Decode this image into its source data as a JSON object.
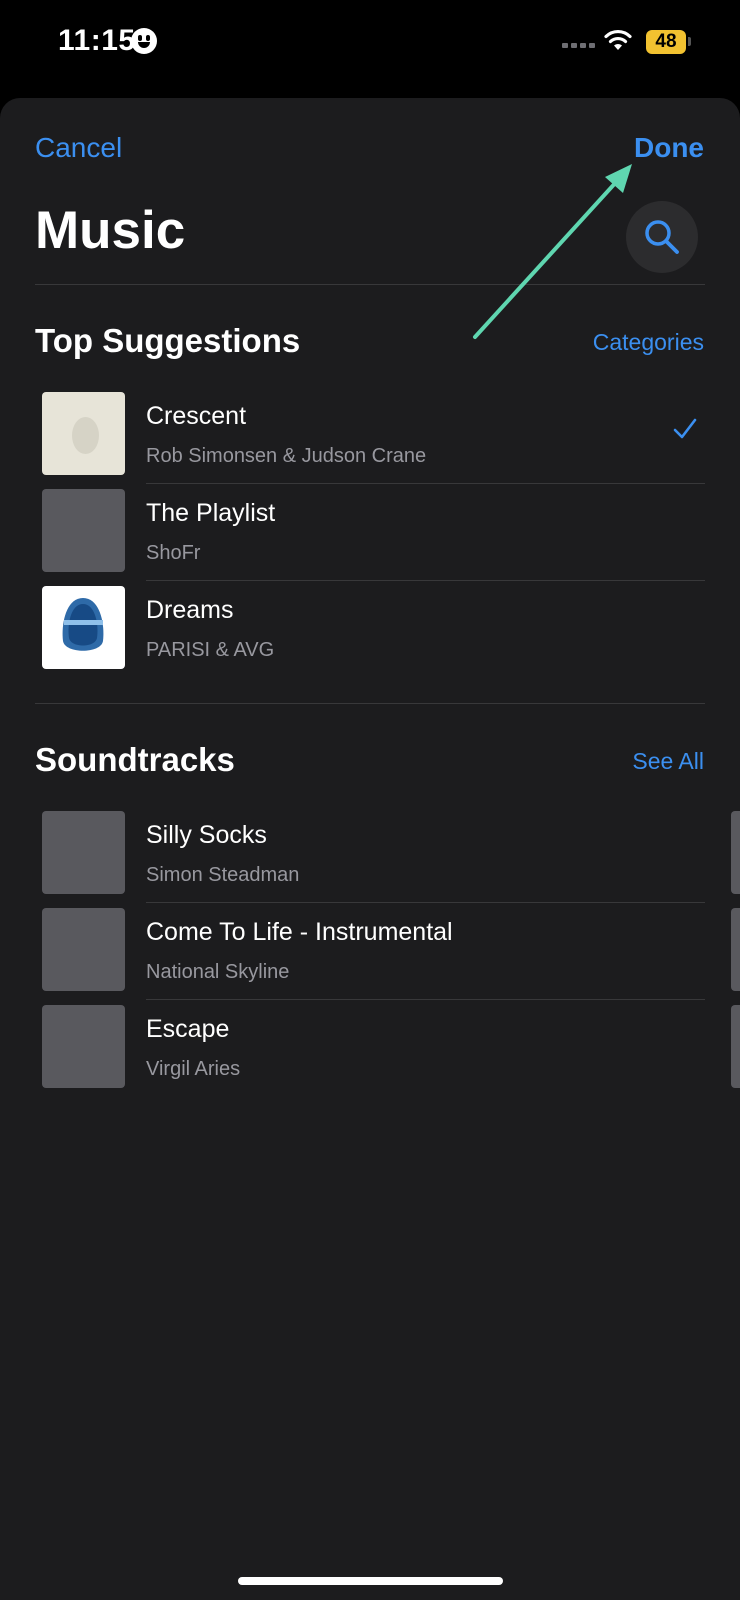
{
  "status_bar": {
    "time": "11:15",
    "battery": "48"
  },
  "nav": {
    "cancel_label": "Cancel",
    "done_label": "Done",
    "title": "Music"
  },
  "top_suggestions": {
    "heading": "Top Suggestions",
    "link": "Categories",
    "items": [
      {
        "title": "Crescent",
        "subtitle": "Rob Simonsen & Judson Crane",
        "selected": true
      },
      {
        "title": "The Playlist",
        "subtitle": "ShoFr",
        "selected": false
      },
      {
        "title": "Dreams",
        "subtitle": "PARISI & AVG",
        "selected": false
      }
    ]
  },
  "soundtracks": {
    "heading": "Soundtracks",
    "link": "See All",
    "items": [
      {
        "title": "Silly Socks",
        "subtitle": "Simon Steadman"
      },
      {
        "title": "Come To Life - Instrumental",
        "subtitle": "National Skyline"
      },
      {
        "title": "Escape",
        "subtitle": "Virgil Aries"
      }
    ]
  },
  "colors": {
    "accent": "#3b8ff0",
    "annotation_arrow": "#5fd6b0",
    "sheet_bg": "#1c1c1e"
  },
  "icons": [
    "smiley-icon",
    "wifi-icon",
    "battery-icon",
    "search-icon",
    "checkmark-icon"
  ]
}
